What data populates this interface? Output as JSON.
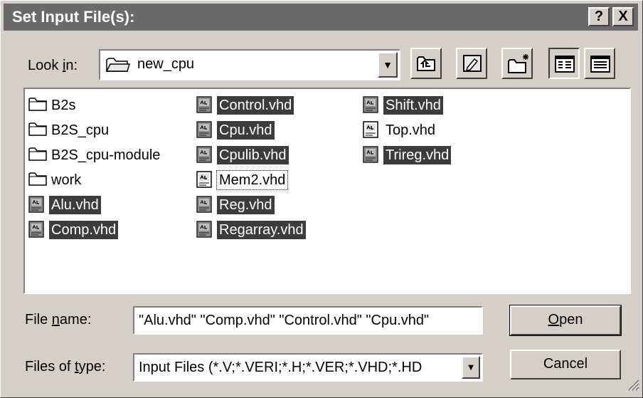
{
  "window": {
    "title": "Set Input File(s):",
    "help_label": "?",
    "close_label": "X"
  },
  "lookin": {
    "label_prefix": "Look ",
    "label_accel": "i",
    "label_suffix": "n:",
    "value": "new_cpu"
  },
  "toolbar": {
    "icons": [
      "up-one-level-icon",
      "desktop-icon",
      "new-folder-icon",
      "list-view-icon",
      "details-view-icon"
    ]
  },
  "files": [
    {
      "name": "B2s",
      "type": "folder",
      "selected": false
    },
    {
      "name": "B2S_cpu",
      "type": "folder",
      "selected": false
    },
    {
      "name": "B2S_cpu-module",
      "type": "folder",
      "selected": false
    },
    {
      "name": "work",
      "type": "folder",
      "selected": false
    },
    {
      "name": "Alu.vhd",
      "type": "file",
      "selected": true
    },
    {
      "name": "Comp.vhd",
      "type": "file",
      "selected": true
    },
    {
      "name": "Control.vhd",
      "type": "file",
      "selected": true
    },
    {
      "name": "Cpu.vhd",
      "type": "file",
      "selected": true
    },
    {
      "name": "Cpulib.vhd",
      "type": "file",
      "selected": true
    },
    {
      "name": "Mem2.vhd",
      "type": "file",
      "selected": false,
      "focused": true
    },
    {
      "name": "Reg.vhd",
      "type": "file",
      "selected": true
    },
    {
      "name": "Regarray.vhd",
      "type": "file",
      "selected": true
    },
    {
      "name": "Shift.vhd",
      "type": "file",
      "selected": true
    },
    {
      "name": "Top.vhd",
      "type": "file",
      "selected": false
    },
    {
      "name": "Trireg.vhd",
      "type": "file",
      "selected": true
    }
  ],
  "filename": {
    "label_prefix": "File ",
    "label_accel": "n",
    "label_suffix": "ame:",
    "value": "\"Alu.vhd\" \"Comp.vhd\" \"Control.vhd\" \"Cpu.vhd\""
  },
  "filetype": {
    "label_prefix": "Files of ",
    "label_accel": "t",
    "label_suffix": "ype:",
    "value": "Input Files (*.V;*.VERI;*.H;*.VER;*.VHD;*.HD"
  },
  "buttons": {
    "open_accel": "O",
    "open_rest": "pen",
    "cancel": "Cancel"
  },
  "colors": {
    "face": "#d4d0c8",
    "title_bar": "#6a6a6a",
    "selection": "#3c3c3c"
  }
}
